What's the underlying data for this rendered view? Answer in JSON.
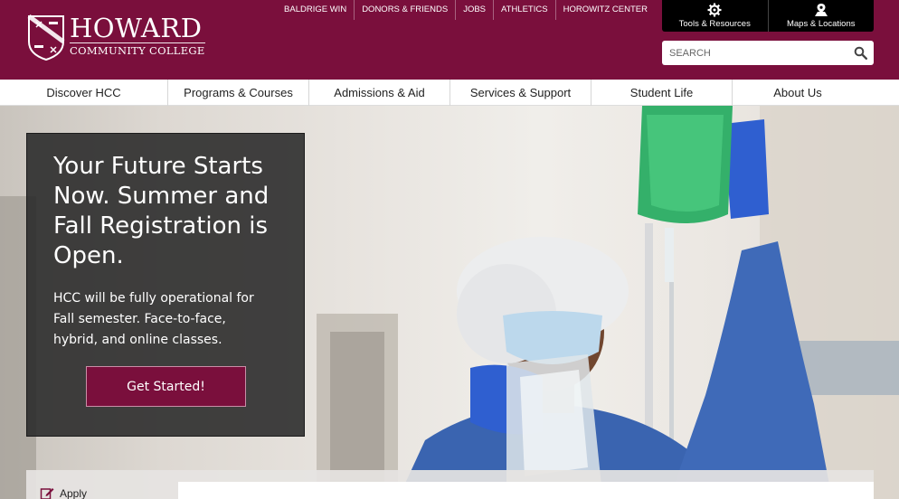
{
  "brand": {
    "name_line1": "HOWARD",
    "name_line2": "COMMUNITY COLLEGE",
    "primary_color": "#7a0f3c"
  },
  "top_links": [
    "BALDRIGE WIN",
    "DONORS & FRIENDS",
    "JOBS",
    "ATHLETICS",
    "HOROWITZ CENTER"
  ],
  "utility": {
    "tools": {
      "label": "Tools & Resources",
      "icon": "gear-icon"
    },
    "maps": {
      "label": "Maps & Locations",
      "icon": "map-pin-icon"
    }
  },
  "search": {
    "placeholder": "SEARCH",
    "icon": "search-icon"
  },
  "nav": [
    "Discover HCC",
    "Programs & Courses",
    "Admissions & Aid",
    "Services & Support",
    "Student Life",
    "About Us"
  ],
  "hero": {
    "headline": "Your Future Starts Now. Summer and Fall Registration is Open.",
    "body": "HCC will be fully operational for Fall semester. Face-to-face, hybrid, and online classes.",
    "cta": "Get Started!"
  },
  "quick": {
    "apply_label": "Apply",
    "apply_icon": "edit-icon"
  }
}
